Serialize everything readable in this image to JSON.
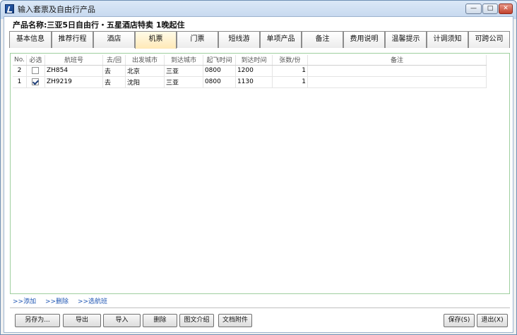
{
  "window": {
    "title": "输入套票及自由行产品",
    "controls": {
      "minimize": "—",
      "maximize": "□",
      "close": "✕"
    }
  },
  "product": {
    "label": "产品名称:三亚5日自由行・五星酒店特卖 1晚起住"
  },
  "tabs": [
    {
      "label": "基本信息"
    },
    {
      "label": "推荐行程"
    },
    {
      "label": "酒店"
    },
    {
      "label": "机票",
      "active": true
    },
    {
      "label": "门票"
    },
    {
      "label": "短线游"
    },
    {
      "label": "单项产品"
    },
    {
      "label": "备注"
    },
    {
      "label": "费用说明"
    },
    {
      "label": "温馨提示"
    },
    {
      "label": "计调须知"
    },
    {
      "label": "可跨公司"
    }
  ],
  "grid": {
    "columns": [
      "No.",
      "必选",
      "航班号",
      "去/回",
      "出发城市",
      "到达城市",
      "起飞时间",
      "到达时间",
      "张数/份",
      "备注"
    ],
    "rows": [
      {
        "no": "2",
        "required": false,
        "flight": "ZH854",
        "direction": "去",
        "from": "北京",
        "to": "三亚",
        "depart": "0800",
        "arrive": "1200",
        "count": "1",
        "note": ""
      },
      {
        "no": "1",
        "required": true,
        "flight": "ZH9219",
        "direction": "去",
        "from": "沈阳",
        "to": "三亚",
        "depart": "0800",
        "arrive": "1130",
        "count": "1",
        "note": ""
      }
    ]
  },
  "links": {
    "add": ">>添加",
    "delete": ">>删除",
    "select_flight": ">>选航班"
  },
  "buttons": {
    "save_as": "另存为...",
    "export": "导出",
    "import": "导入",
    "delete": "删除",
    "text_intro": "图文介绍",
    "doc_attach": "文档附件",
    "save": "保存(S)",
    "exit": "退出(X)"
  }
}
